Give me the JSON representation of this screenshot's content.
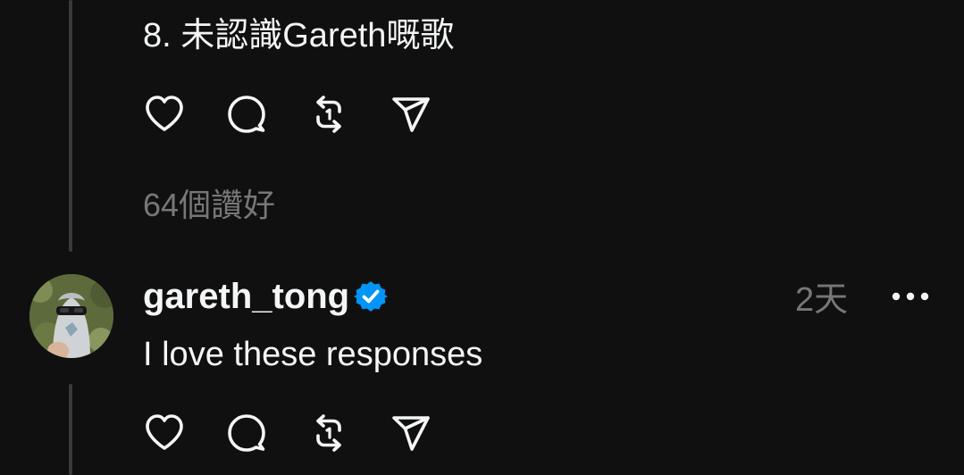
{
  "previous_post": {
    "text": "8. 未認識Gareth嘅歌",
    "likes_text": "64個讚好",
    "actions": {
      "like_icon": "heart-icon",
      "reply_icon": "comment-icon",
      "repost_icon": "repost-icon",
      "share_icon": "send-icon"
    }
  },
  "reply": {
    "username": "gareth_tong",
    "verified": true,
    "verified_color": "#0095f6",
    "timestamp": "2天",
    "text": "I love these responses",
    "more_icon": "more-icon",
    "actions": {
      "like_icon": "heart-icon",
      "reply_icon": "comment-icon",
      "repost_icon": "repost-icon",
      "share_icon": "send-icon"
    }
  },
  "colors": {
    "background": "#101010",
    "primary_text": "#f3f5f7",
    "secondary_text": "#777777",
    "thread_line": "#3a3a3a"
  }
}
